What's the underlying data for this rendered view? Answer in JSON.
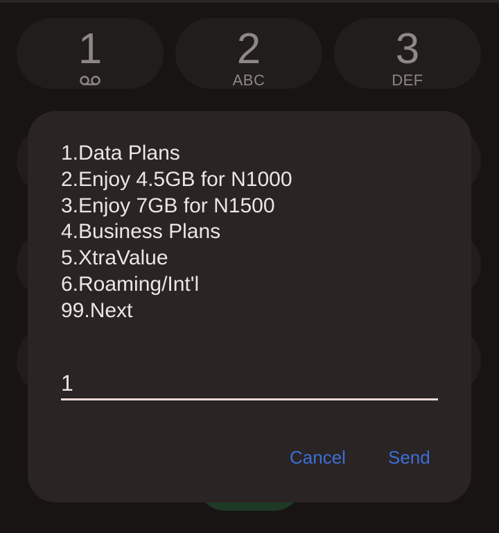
{
  "dialpad": {
    "keys": [
      {
        "digit": "1",
        "letters": "",
        "icon": "voicemail-icon"
      },
      {
        "digit": "2",
        "letters": "ABC"
      },
      {
        "digit": "3",
        "letters": "DEF"
      }
    ]
  },
  "dialog": {
    "menu_items": [
      "1.Data Plans",
      "2.Enjoy 4.5GB for N1000",
      "3.Enjoy 7GB for N1500",
      "4.Business Plans",
      "5.XtraValue",
      "6.Roaming/Int'l",
      "99.Next"
    ],
    "reply_value": "1",
    "cancel_label": "Cancel",
    "send_label": "Send"
  },
  "colors": {
    "background": "#181414",
    "dialog_background": "#2a2424",
    "accent": "#3b6fd8",
    "input_underline": "#f3d9d9"
  }
}
